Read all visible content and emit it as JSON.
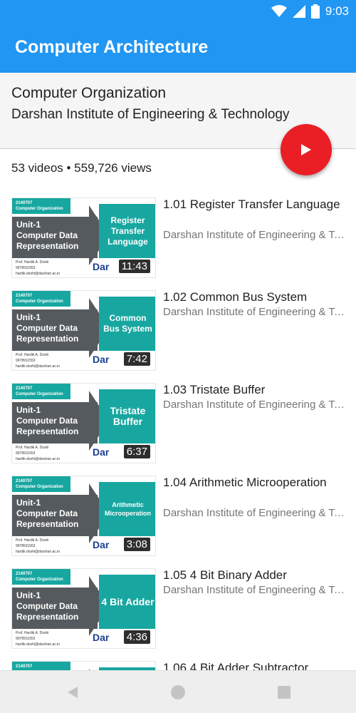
{
  "status_bar": {
    "time": "9:03"
  },
  "app_bar": {
    "title": "Computer Architecture"
  },
  "playlist": {
    "title": "Computer Organization",
    "channel": "Darshan Institute of Engineering & Technology",
    "stats": "53 videos • 559,726 views"
  },
  "colors": {
    "accent": "#2196f3",
    "fab": "#ea1e25",
    "teal": "#17a7a0"
  },
  "thumbnail_common": {
    "code": "2140707",
    "subject": "Computer Organization",
    "unit": "Unit-1",
    "unit_title_1": "Computer Data",
    "unit_title_2": "Representation",
    "prof": "Prof. Hardik A. Doshi",
    "phone": "9978911553",
    "email": "hardik.doshi@darshan.ac.in",
    "logo": "Dar"
  },
  "videos": [
    {
      "title": "1.01 Register Transfer Language",
      "channel": "Darshan Institute of Engineering & Technology",
      "duration": "11:43",
      "thumb_topic": "Register Transfer Language"
    },
    {
      "title": "1.02 Common Bus System",
      "channel": "Darshan Institute of Engineering & Technology",
      "duration": "7:42",
      "thumb_topic": "Common Bus System"
    },
    {
      "title": "1.03 Tristate Buffer",
      "channel": "Darshan Institute of Engineering & Technology",
      "duration": "6:37",
      "thumb_topic": "Tristate Buffer"
    },
    {
      "title": "1.04 Arithmetic Microoperation",
      "channel": "Darshan Institute of Engineering & Technology",
      "duration": "3:08",
      "thumb_topic": "Arithmetic Microoperation"
    },
    {
      "title": "1.05 4 Bit Binary Adder",
      "channel": "Darshan Institute of Engineering & Technology",
      "duration": "4:36",
      "thumb_topic": "4 Bit Adder"
    },
    {
      "title": "1.06 4 Bit Adder Subtractor",
      "channel": "",
      "duration": "",
      "thumb_topic": ""
    }
  ]
}
